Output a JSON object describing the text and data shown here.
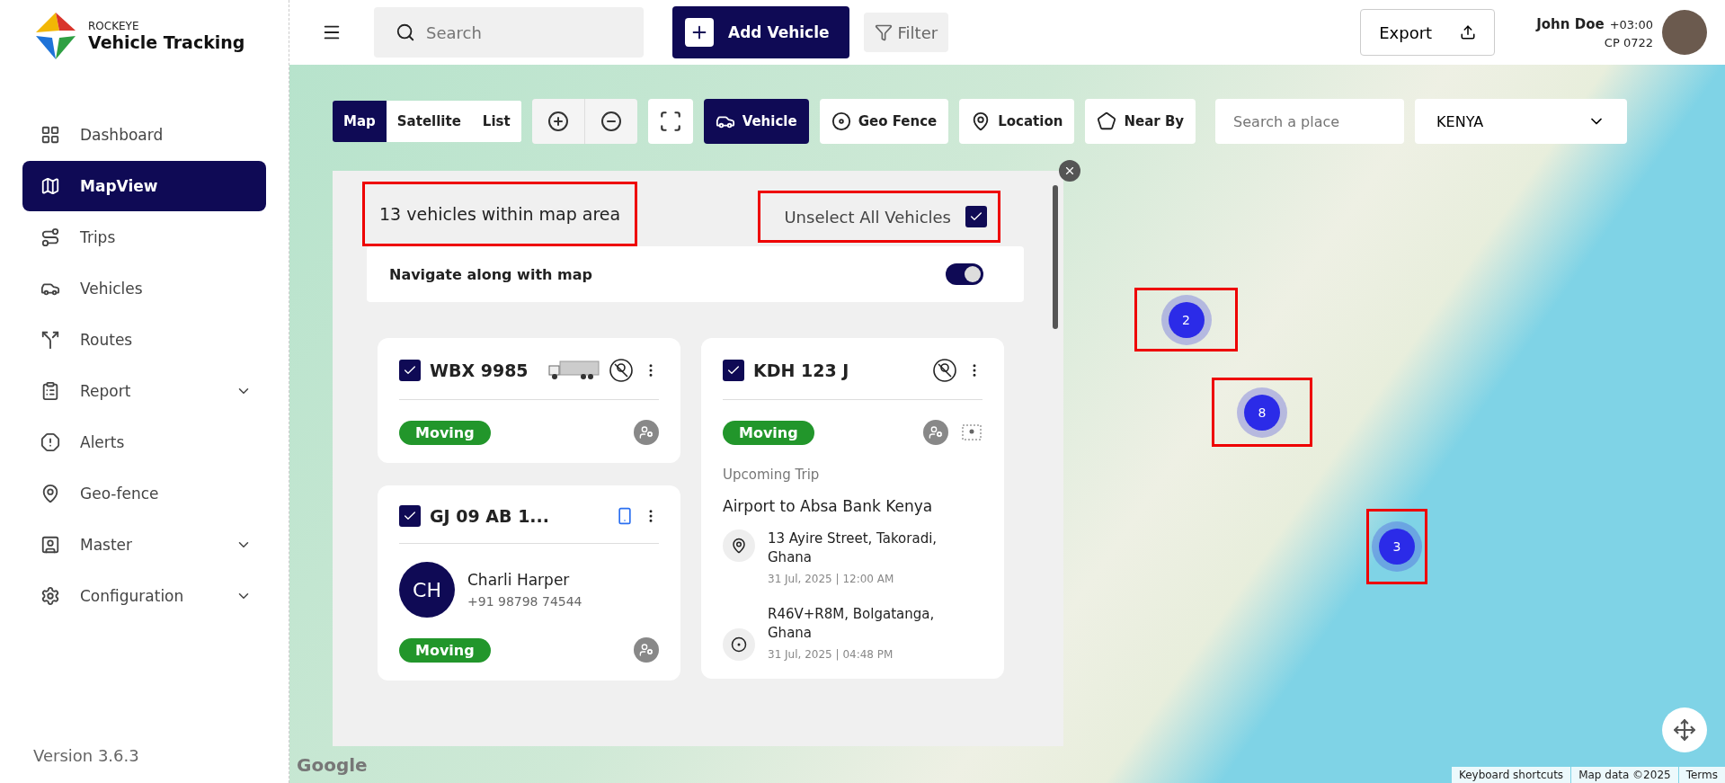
{
  "brand": {
    "overline": "ROCKEYE",
    "name": "Vehicle Tracking"
  },
  "nav": [
    {
      "label": "Dashboard",
      "selected": false,
      "expandable": false
    },
    {
      "label": "MapView",
      "selected": true,
      "expandable": false
    },
    {
      "label": "Trips",
      "selected": false,
      "expandable": false
    },
    {
      "label": "Vehicles",
      "selected": false,
      "expandable": false
    },
    {
      "label": "Routes",
      "selected": false,
      "expandable": false
    },
    {
      "label": "Report",
      "selected": false,
      "expandable": true
    },
    {
      "label": "Alerts",
      "selected": false,
      "expandable": false
    },
    {
      "label": "Geo-fence",
      "selected": false,
      "expandable": false
    },
    {
      "label": "Master",
      "selected": false,
      "expandable": true
    },
    {
      "label": "Configuration",
      "selected": false,
      "expandable": true
    }
  ],
  "version": "Version 3.6.3",
  "topbar": {
    "search_placeholder": "Search",
    "add_button": "Add Vehicle",
    "filter_button": "Filter",
    "export_button": "Export",
    "user": {
      "name": "John Doe",
      "timezone": "+03:00",
      "code": "CP 0722"
    }
  },
  "map_toolbar": {
    "view_tabs": [
      {
        "label": "Map",
        "selected": true
      },
      {
        "label": "Satellite",
        "selected": false
      },
      {
        "label": "List",
        "selected": false
      }
    ],
    "layers": [
      {
        "label": "Vehicle",
        "selected": true
      },
      {
        "label": "Geo Fence",
        "selected": false
      },
      {
        "label": "Location",
        "selected": false
      },
      {
        "label": "Near By",
        "selected": false
      }
    ],
    "place_search_placeholder": "Search a place",
    "country": "KENYA"
  },
  "panel": {
    "count_text": "13 vehicles within map area",
    "count_highlighted": true,
    "unselect_label": "Unselect All Vehicles",
    "unselect_checked": true,
    "unselect_highlighted": true,
    "navigate_label": "Navigate along with map",
    "navigate_on": true,
    "columns": [
      [
        {
          "plate": "WBX 9985",
          "checked": true,
          "status": "Moving"
        },
        {
          "plate": "GJ 09 AB 1...",
          "checked": true,
          "driver": {
            "initials": "CH",
            "name": "Charli Harper",
            "phone": "+91 98798 74544"
          },
          "status": "Moving"
        }
      ],
      [
        {
          "plate": "KDH 123 J",
          "checked": true,
          "status": "Moving",
          "trip": {
            "heading": "Upcoming Trip",
            "title": "Airport to Absa Bank Kenya",
            "stops": [
              {
                "kind": "origin",
                "address": "13 Ayire Street, Takoradi, Ghana",
                "time": "31 Jul, 2025 | 12:00 AM"
              },
              {
                "kind": "destination",
                "address": "R46V+R8M, Bolgatanga, Ghana",
                "time": "31 Jul, 2025 | 04:48 PM"
              }
            ]
          }
        }
      ]
    ]
  },
  "map": {
    "clusters": [
      {
        "count": "2",
        "highlighted": true
      },
      {
        "count": "8",
        "highlighted": true
      },
      {
        "count": "3",
        "highlighted": true
      }
    ],
    "logo": "Google",
    "attribution": [
      "Keyboard shortcuts",
      "Map data ©2025",
      "Terms"
    ]
  }
}
